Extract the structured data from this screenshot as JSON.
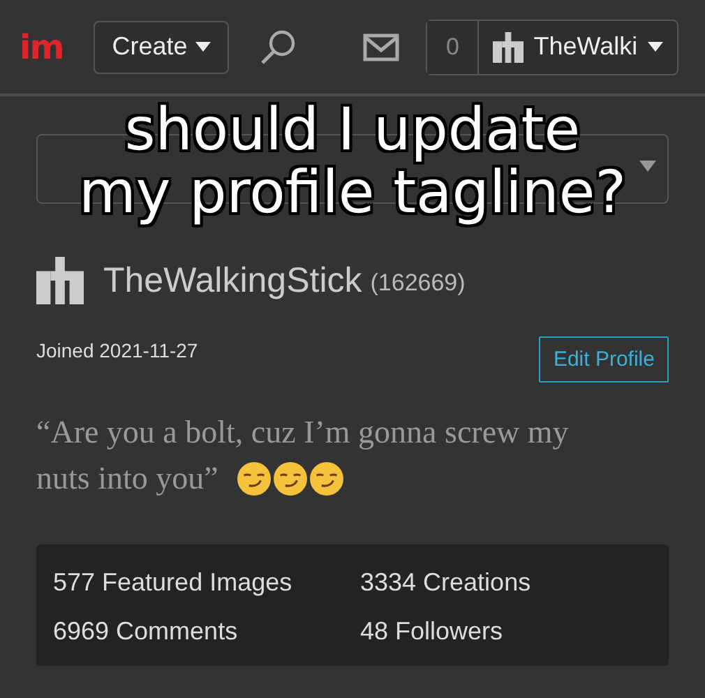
{
  "header": {
    "logo": "im",
    "create_button": "Create",
    "notification_count": "0",
    "user_button": "TheWalki"
  },
  "caption": [
    "should I update",
    "my profile tagline?"
  ],
  "profile": {
    "username": "TheWalkingStick",
    "points": "(162669)",
    "joined": "Joined 2021-11-27",
    "edit_button": "Edit Profile",
    "tagline": [
      "“Are you a bolt, cuz I’m gonna screw my",
      "nuts into you”"
    ]
  },
  "stats": [
    {
      "label": "577 Featured Images"
    },
    {
      "label": "3334 Creations"
    },
    {
      "label": "6969 Comments"
    },
    {
      "label": "48 Followers"
    }
  ]
}
